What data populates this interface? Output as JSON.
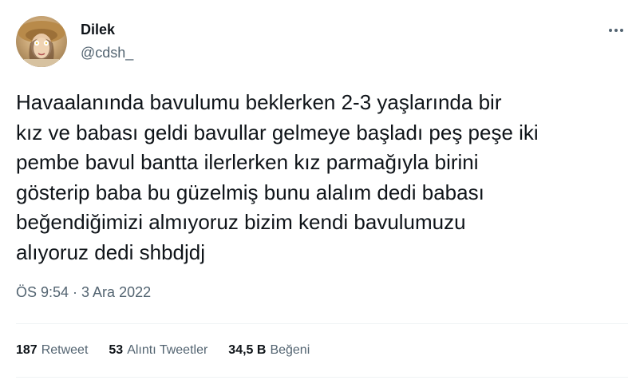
{
  "author": {
    "name": "Dilek",
    "handle": "@cdsh_"
  },
  "tweet": {
    "text": "Havaalanında bavulumu beklerken 2-3 yaşlarında bir\nkız ve babası geldi bavullar gelmeye başladı peş peşe iki\npembe bavul bantta ilerlerken kız parmağıyla birini\ngösterip baba bu güzelmiş bunu alalım dedi babası\nbeğendiğimizi almıyoruz bizim kendi bavulumuzu\nalıyoruz dedi shbdjdj",
    "time": "ÖS 9:54 · 3 Ara 2022"
  },
  "stats": {
    "retweets": {
      "count": "187",
      "label": "Retweet"
    },
    "quotes": {
      "count": "53",
      "label": "Alıntı Tweetler"
    },
    "likes": {
      "count": "34,5 B",
      "label": "Beğeni"
    }
  },
  "icons": {
    "more": "more-options-icon"
  }
}
